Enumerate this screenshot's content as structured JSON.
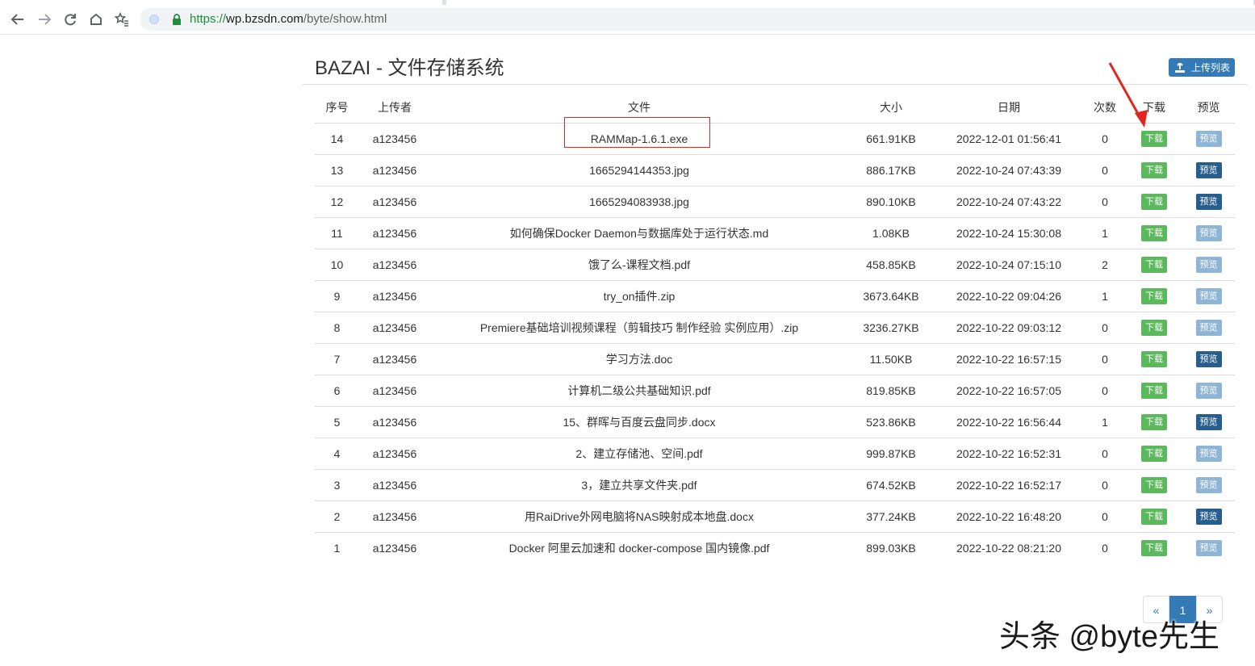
{
  "browser": {
    "url_scheme": "https://",
    "url_host": "wp.bzsdn.com",
    "url_path": "/byte/show.html"
  },
  "page": {
    "title": "BAZAI - 文件存储系统",
    "upload_list_label": "上传列表"
  },
  "table": {
    "columns": [
      "序号",
      "上传者",
      "文件",
      "大小",
      "日期",
      "次数",
      "下载",
      "预览"
    ],
    "download_label": "下载",
    "preview_label": "预览",
    "rows": [
      {
        "id": "14",
        "uploader": "a123456",
        "file": "RAMMap-1.6.1.exe",
        "size": "661.91KB",
        "date": "2022-12-01 01:56:41",
        "count": "0",
        "preview_enabled": false
      },
      {
        "id": "13",
        "uploader": "a123456",
        "file": "1665294144353.jpg",
        "size": "886.17KB",
        "date": "2022-10-24 07:43:39",
        "count": "0",
        "preview_enabled": true
      },
      {
        "id": "12",
        "uploader": "a123456",
        "file": "1665294083938.jpg",
        "size": "890.10KB",
        "date": "2022-10-24 07:43:22",
        "count": "0",
        "preview_enabled": true
      },
      {
        "id": "11",
        "uploader": "a123456",
        "file": "如何确保Docker Daemon与数据库处于运行状态.md",
        "size": "1.08KB",
        "date": "2022-10-24 15:30:08",
        "count": "1",
        "preview_enabled": false
      },
      {
        "id": "10",
        "uploader": "a123456",
        "file": "饿了么-课程文档.pdf",
        "size": "458.85KB",
        "date": "2022-10-24 07:15:10",
        "count": "2",
        "preview_enabled": false
      },
      {
        "id": "9",
        "uploader": "a123456",
        "file": "try_on插件.zip",
        "size": "3673.64KB",
        "date": "2022-10-22 09:04:26",
        "count": "1",
        "preview_enabled": false
      },
      {
        "id": "8",
        "uploader": "a123456",
        "file": "Premiere基础培训视频课程（剪辑技巧 制作经验 实例应用）.zip",
        "size": "3236.27KB",
        "date": "2022-10-22 09:03:12",
        "count": "0",
        "preview_enabled": false
      },
      {
        "id": "7",
        "uploader": "a123456",
        "file": "学习方法.doc",
        "size": "11.50KB",
        "date": "2022-10-22 16:57:15",
        "count": "0",
        "preview_enabled": true
      },
      {
        "id": "6",
        "uploader": "a123456",
        "file": "计算机二级公共基础知识.pdf",
        "size": "819.85KB",
        "date": "2022-10-22 16:57:05",
        "count": "0",
        "preview_enabled": false
      },
      {
        "id": "5",
        "uploader": "a123456",
        "file": "15、群晖与百度云盘同步.docx",
        "size": "523.86KB",
        "date": "2022-10-22 16:56:44",
        "count": "1",
        "preview_enabled": true
      },
      {
        "id": "4",
        "uploader": "a123456",
        "file": "2、建立存储池、空间.pdf",
        "size": "999.87KB",
        "date": "2022-10-22 16:52:31",
        "count": "0",
        "preview_enabled": false
      },
      {
        "id": "3",
        "uploader": "a123456",
        "file": "3，建立共享文件夹.pdf",
        "size": "674.52KB",
        "date": "2022-10-22 16:52:17",
        "count": "0",
        "preview_enabled": false
      },
      {
        "id": "2",
        "uploader": "a123456",
        "file": "用RaiDrive外网电脑将NAS映射成本地盘.docx",
        "size": "377.24KB",
        "date": "2022-10-22 16:48:20",
        "count": "0",
        "preview_enabled": true
      },
      {
        "id": "1",
        "uploader": "a123456",
        "file": "Docker 阿里云加速和 docker-compose 国内镜像.pdf",
        "size": "899.03KB",
        "date": "2022-10-22 08:21:20",
        "count": "0",
        "preview_enabled": false
      }
    ]
  },
  "pagination": {
    "prev": "«",
    "current": "1",
    "next": "»"
  },
  "watermark": {
    "text": "头条 @byte先生"
  },
  "colors": {
    "primary": "#337ab7",
    "download_green": "#5cb85c",
    "preview_dark": "#285e8e",
    "preview_disabled": "#8fb5d6",
    "annotation_red": "#e0261f"
  }
}
